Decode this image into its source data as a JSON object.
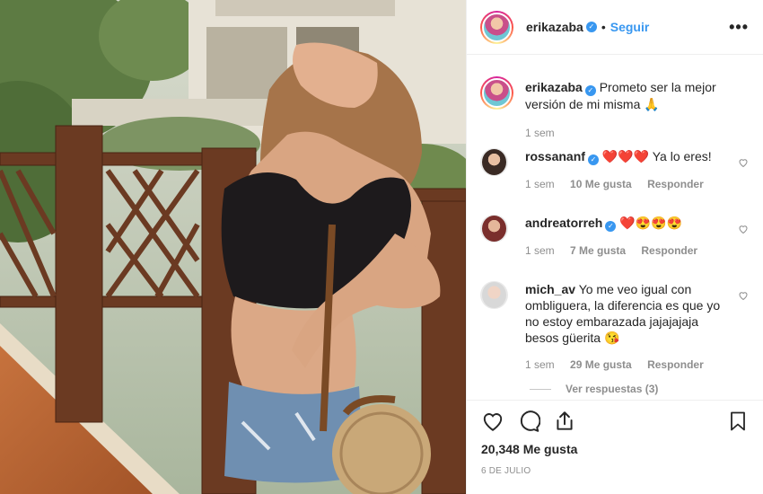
{
  "header": {
    "username": "erikazaba",
    "separator": "•",
    "follow_label": "Seguir",
    "more_label": "•••"
  },
  "caption": {
    "username": "erikazaba",
    "text": "Prometo ser la mejor versión de mi misma 🙏",
    "time": "1 sem"
  },
  "comments": [
    {
      "username": "rossananf",
      "verified": true,
      "text": "❤️❤️❤️ Ya lo eres!",
      "time": "1 sem",
      "likes": "10 Me gusta",
      "reply": "Responder"
    },
    {
      "username": "andreatorreh",
      "verified": true,
      "text": "❤️😍😍😍",
      "time": "1 sem",
      "likes": "7 Me gusta",
      "reply": "Responder"
    },
    {
      "username": "mich_av",
      "verified": false,
      "text": "Yo me veo igual con ombliguera, la diferencia es que yo no estoy embarazada jajajajaja besos güerita 😘",
      "time": "1 sem",
      "likes": "29 Me gusta",
      "reply": "Responder"
    }
  ],
  "view_replies": "Ver respuestas (3)",
  "likes_count": "20,348 Me gusta",
  "post_date": "6 DE JULIO",
  "icons": [
    "heart-icon",
    "comment-icon",
    "share-icon",
    "bookmark-icon",
    "more-icon",
    "verified-icon"
  ],
  "colors": {
    "accent": "#3897f0",
    "text": "#262626",
    "muted": "#8e8e8e",
    "border": "#efefef"
  }
}
